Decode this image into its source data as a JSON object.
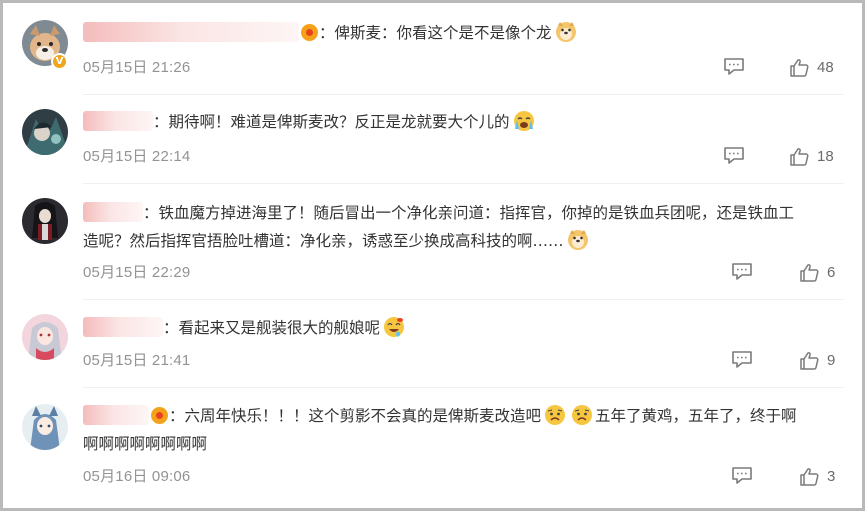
{
  "comments": [
    {
      "author_suffix": "：",
      "text_a": "俾斯麦：你看这个是不是像个龙",
      "text_b": "",
      "date": "05月15日 21:26",
      "likes": "48",
      "verified_badge": "V",
      "emoji": "doge-emoji"
    },
    {
      "author_suffix": "：",
      "text_a": "期待啊！难道是俾斯麦改？反正是龙就要大个儿的",
      "text_b": "",
      "date": "05月15日 22:14",
      "likes": "18",
      "emoji": "crying-emoji"
    },
    {
      "author_suffix": "：",
      "text_a": "铁血魔方掉进海里了！随后冒出一个净化亲问道：指挥官，你掉的是铁血兵团呢，还是铁血工",
      "text_b": "造呢？然后指挥官捂脸吐槽道：净化亲，诱惑至少换成高科技的啊……",
      "date": "05月15日 22:29",
      "likes": "6",
      "emoji": "doge-emoji"
    },
    {
      "author_suffix": "：",
      "text_a": "看起来又是舰装很大的舰娘呢",
      "text_b": "",
      "date": "05月15日 21:41",
      "likes": "9",
      "emoji": "drool-emoji"
    },
    {
      "author_suffix": "：",
      "text_a1": "六周年快乐！！！这个剪影不会真的是俾斯麦改造吧",
      "text_a2": "五年了黄鸡，五年了，终于啊",
      "text_b": "啊啊啊啊啊啊啊啊",
      "date": "05月16日 09:06",
      "likes": "3",
      "emoji": "sad-emoji"
    }
  ],
  "icons": {
    "reply": "comment-reply-icon",
    "like": "thumbs-up-icon"
  },
  "colors": {
    "text": "#333333",
    "meta": "#939393",
    "border": "#b9b9b9",
    "emoji_yellow": "#f7c640"
  }
}
